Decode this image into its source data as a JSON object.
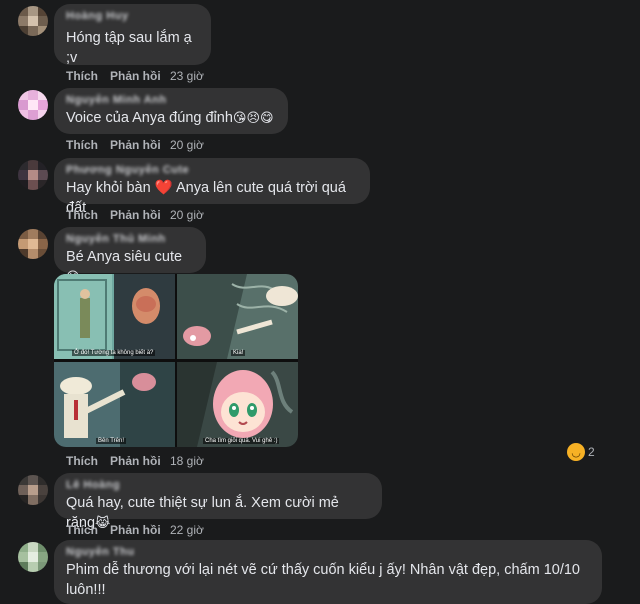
{
  "comments": [
    {
      "author": "Hoàng Huy",
      "text": "Hóng tập sau lắm ạ ;v",
      "emojis": "",
      "like": "Thích",
      "reply": "Phản hồi",
      "time": "23 giờ"
    },
    {
      "author": "Nguyễn Minh Anh",
      "text": "Voice của Anya đúng đỉnh",
      "emojis": "😘😣😋",
      "like": "Thích",
      "reply": "Phản hồi",
      "time": "20 giờ"
    },
    {
      "author": "Phương Nguyễn Cute",
      "text_before": "Hay khỏi bàn",
      "heart": "❤️",
      "text_after": "Anya lên cute quá trời quá đất",
      "like": "Thích",
      "reply": "Phản hồi",
      "time": "20 giờ"
    },
    {
      "author": "Nguyễn Thủ Minh",
      "text": "Bé Anya siêu cute",
      "emojis": "😆",
      "like": "Thích",
      "reply": "Phản hồi",
      "time": "18 giờ"
    },
    {
      "author": "Lê Hoàng",
      "text": "Quá hay, cute thiệt sự lun ắ. Xem cười mẻ răng",
      "emojis": "😹",
      "like": "Thích",
      "reply": "Phản hồi",
      "time": "22 giờ"
    },
    {
      "author": "Nguyễn Thu",
      "text": "Phim dễ thương với lại nét vẽ cứ thấy cuốn kiểu j ấy! Nhân vật đẹp, chấm 10/10 luôn!!!"
    }
  ],
  "image_captions": [
    "Ở đó! Tường ta không biết à?",
    "Kia!",
    "Bên Trên!",
    "Cha tìm giỏi quá. Vui ghê :)"
  ],
  "reaction": {
    "icon": "haha-icon",
    "count": "2"
  },
  "colors": {
    "background": "#1a1b1c",
    "bubble": "#333334",
    "text": "#e4e6eb",
    "meta": "#b0b3b8",
    "heart": "#f02849"
  }
}
